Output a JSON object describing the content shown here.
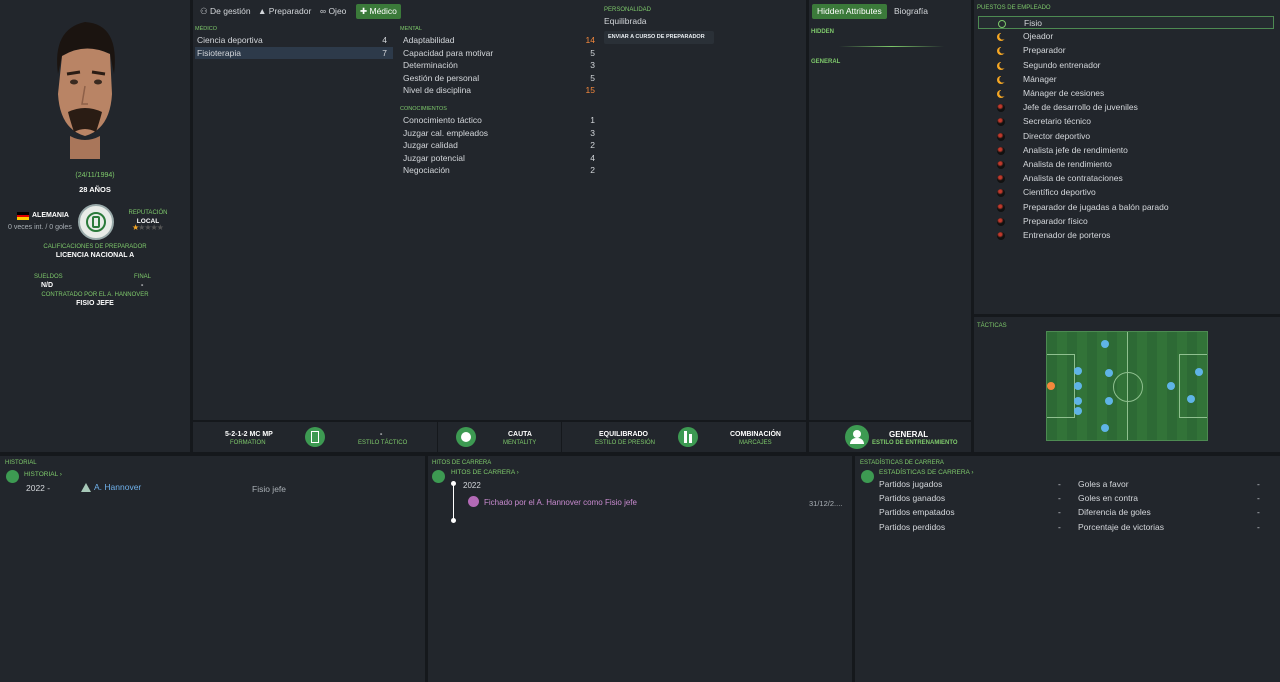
{
  "profile": {
    "dob": "(24/11/1994)",
    "age": "28 AÑOS",
    "nation": "ALEMANIA",
    "caps": "0 veces int. / 0 goles",
    "reputation_label": "REPUTACIÓN",
    "reputation_value": "LOCAL",
    "reputation_stars": 1,
    "coaching_label": "CALIFICACIONES DE PREPARADOR",
    "coaching_value": "LICENCIA NACIONAL A",
    "wage_label": "SUELDOS",
    "wage_value": "N/D",
    "final_label": "FINAL",
    "final_value": "-",
    "contract_label": "CONTRATADO POR EL A. HANNOVER",
    "contract_value": "FISIO JEFE"
  },
  "tabs": [
    {
      "label": "De gestión",
      "icon": "user-icon",
      "active": false
    },
    {
      "label": "Preparador",
      "icon": "cone-icon",
      "active": false
    },
    {
      "label": "Ojeo",
      "icon": "binoculars-icon",
      "active": false
    },
    {
      "label": "Médico",
      "icon": "medkit-icon",
      "active": true
    }
  ],
  "medico": {
    "heading": "MÉDICO",
    "items": [
      {
        "label": "Ciencia deportiva",
        "value": "4"
      },
      {
        "label": "Fisioterapia",
        "value": "7"
      }
    ]
  },
  "mental": {
    "heading": "MENTAL",
    "items": [
      {
        "label": "Adaptabilidad",
        "value": "14",
        "highlight": true
      },
      {
        "label": "Capacidad para motivar",
        "value": "5"
      },
      {
        "label": "Determinación",
        "value": "3"
      },
      {
        "label": "Gestión de personal",
        "value": "5"
      },
      {
        "label": "Nivel de disciplina",
        "value": "15",
        "highlight": true
      }
    ]
  },
  "knowledge": {
    "heading": "CONOCIMIENTOS",
    "items": [
      {
        "label": "Conocimiento táctico",
        "value": "1"
      },
      {
        "label": "Juzgar cal. empleados",
        "value": "3"
      },
      {
        "label": "Juzgar calidad",
        "value": "2"
      },
      {
        "label": "Juzgar potencial",
        "value": "4"
      },
      {
        "label": "Negociación",
        "value": "2"
      }
    ]
  },
  "personality": {
    "heading": "PERSONALIDAD",
    "value": "Equilibrada",
    "course_button": "ENVIAR A CURSO DE PREPARADOR"
  },
  "hidden": {
    "tab_hidden": "Hidden Attributes",
    "tab_bio": "Biografía",
    "hidden_heading": "HIDDEN",
    "general_heading": "GENERAL"
  },
  "tactics_bar": {
    "formation": "5-2-1-2 MC MP",
    "formation_sub": "FORMATION",
    "style": "-",
    "style_sub": "ESTILO TÁCTICO",
    "mentality": "CAUTA",
    "mentality_sub": "MENTALITY",
    "press": "EQUILIBRADO",
    "press_sub": "ESTILO DE PRESIÓN",
    "marking": "COMBINACIÓN",
    "marking_sub": "MARCAJES",
    "training": "GENERAL",
    "training_sub": "ESTILO DE ENTRENAMIENTO"
  },
  "roles": {
    "heading": "PUESTOS DE EMPLEADO",
    "items": [
      {
        "label": "Fisio",
        "status": "ring"
      },
      {
        "label": "Ojeador",
        "status": "crescent"
      },
      {
        "label": "Preparador",
        "status": "crescent"
      },
      {
        "label": "Segundo entrenador",
        "status": "crescent"
      },
      {
        "label": "Mánager",
        "status": "crescent"
      },
      {
        "label": "Mánager de cesiones",
        "status": "crescent"
      },
      {
        "label": "Jefe de desarrollo de juveniles",
        "status": "dark"
      },
      {
        "label": "Secretario técnico",
        "status": "dark"
      },
      {
        "label": "Director deportivo",
        "status": "dark"
      },
      {
        "label": "Analista jefe de rendimiento",
        "status": "dark"
      },
      {
        "label": "Analista de rendimiento",
        "status": "dark"
      },
      {
        "label": "Analista de contrataciones",
        "status": "dark"
      },
      {
        "label": "Científico deportivo",
        "status": "dark"
      },
      {
        "label": "Preparador de jugadas a balón parado",
        "status": "dark"
      },
      {
        "label": "Preparador físico",
        "status": "dark"
      },
      {
        "label": "Entrenador de porteros",
        "status": "dark"
      }
    ]
  },
  "tactics": {
    "heading": "TÁCTICAS"
  },
  "history": {
    "heading": "HISTORIAL",
    "link": "HISTORIAL ›",
    "rows": [
      {
        "year": "2022 -",
        "club": "A. Hannover",
        "role": "Fisio jefe"
      }
    ]
  },
  "milestones": {
    "heading": "HITOS DE CARRERA",
    "link": "HITOS DE CARRERA ›",
    "year": "2022",
    "event": "Fichado por el A. Hannover como Fisio jefe",
    "date": "31/12/2...."
  },
  "career_stats": {
    "heading": "ESTADÍSTICAS DE CARRERA",
    "link": "ESTADÍSTICAS DE CARRERA ›",
    "left": [
      {
        "label": "Partidos jugados",
        "value": "-"
      },
      {
        "label": "Partidos ganados",
        "value": "-"
      },
      {
        "label": "Partidos empatados",
        "value": "-"
      },
      {
        "label": "Partidos perdidos",
        "value": "-"
      }
    ],
    "right": [
      {
        "label": "Goles a favor",
        "value": "-"
      },
      {
        "label": "Goles en contra",
        "value": "-"
      },
      {
        "label": "Diferencia de goles",
        "value": "-"
      },
      {
        "label": "Porcentaje de victorias",
        "value": "-"
      }
    ]
  },
  "colors": {
    "accent": "#7ec96b",
    "highlight": "#f5883c",
    "panel": "#22262c",
    "pitch": "#2d6a35"
  }
}
